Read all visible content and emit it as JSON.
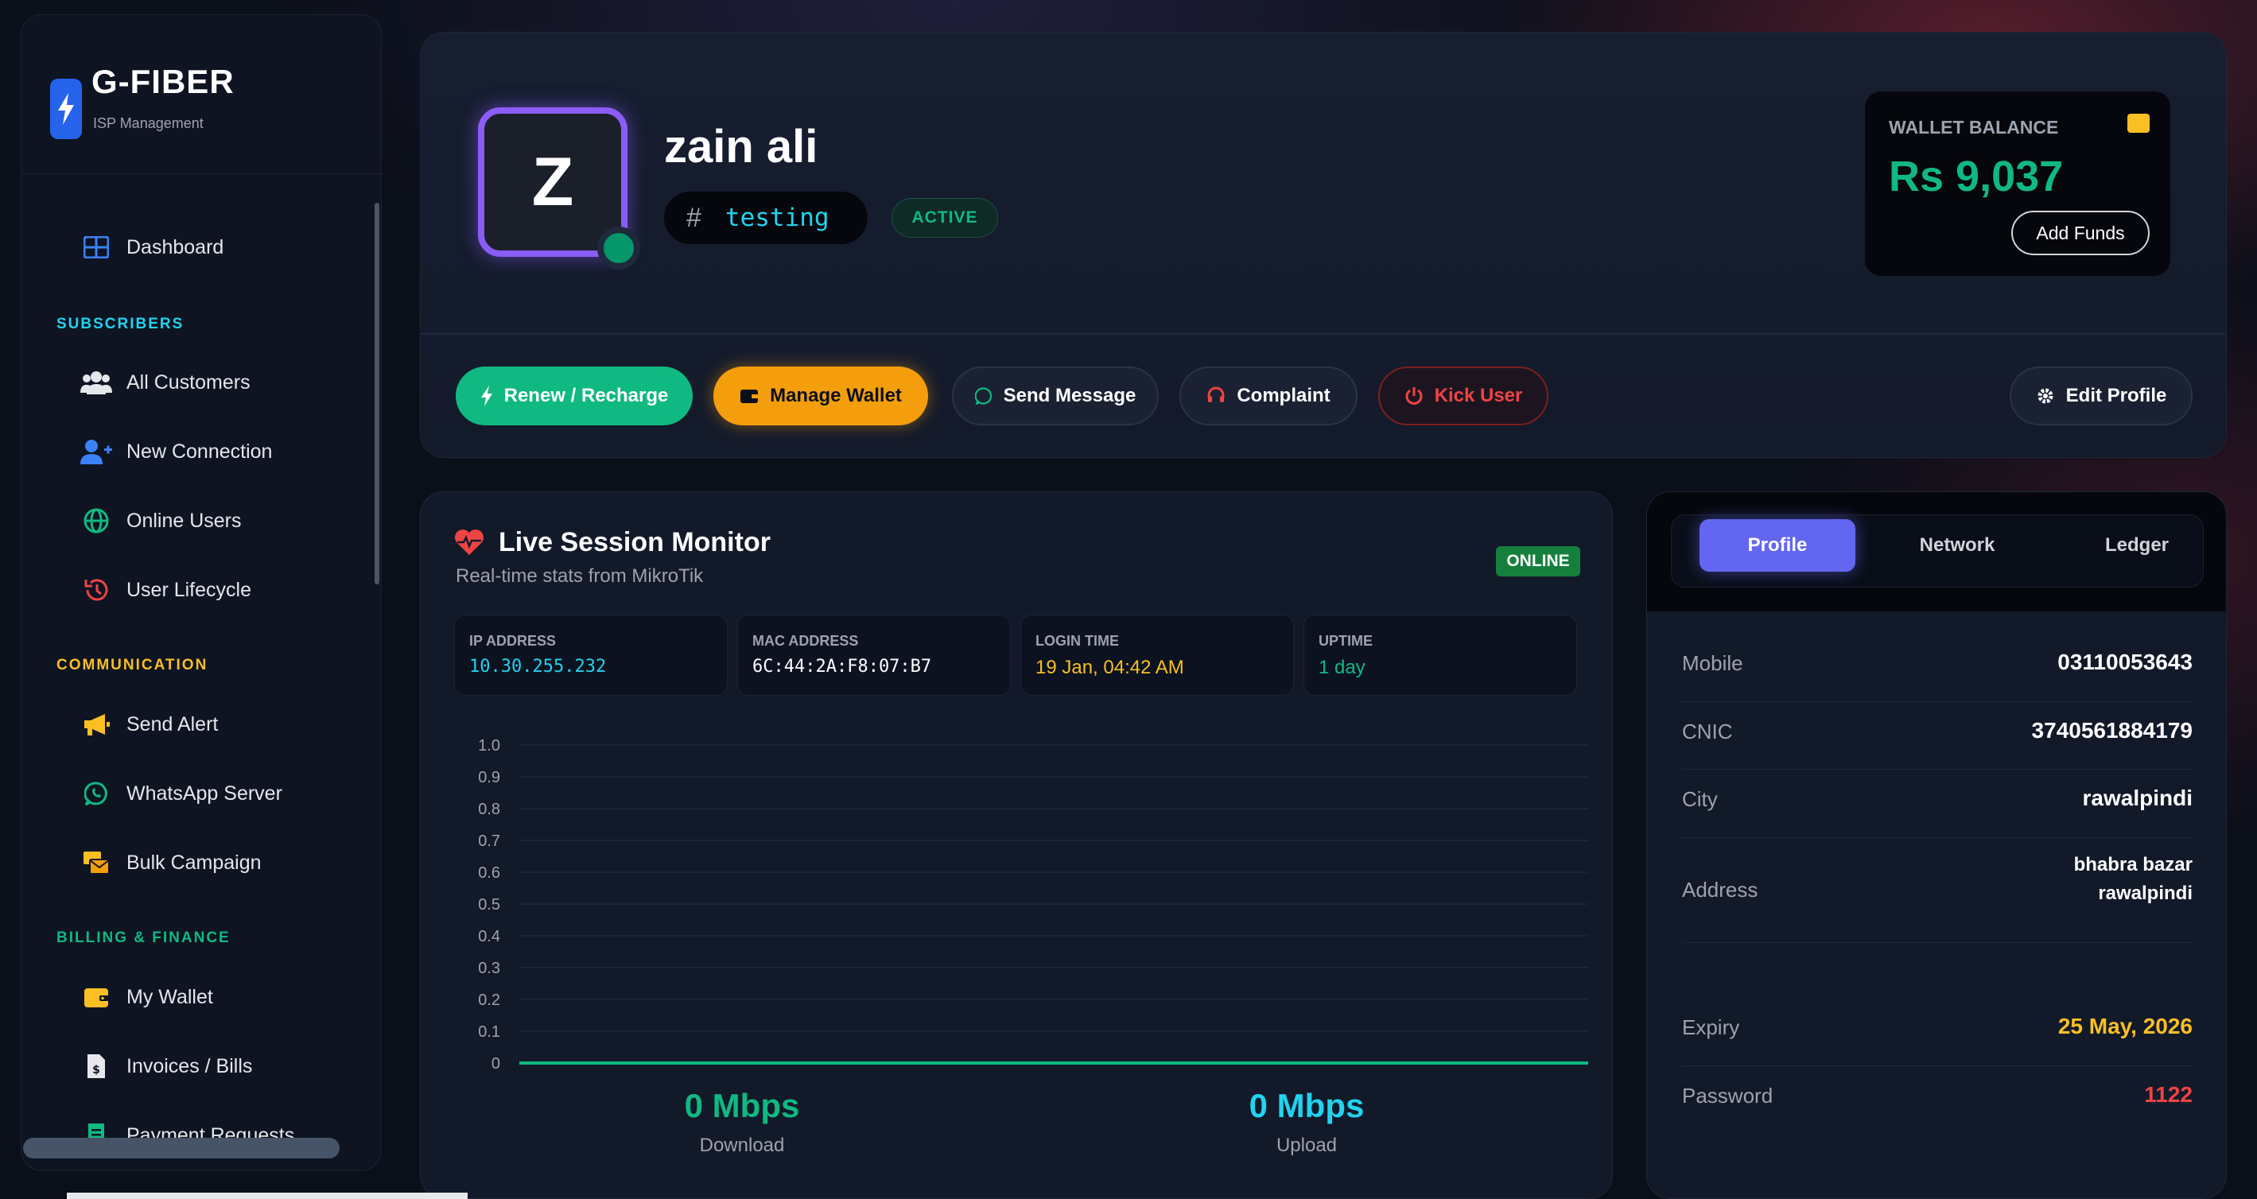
{
  "brand": {
    "name": "G-FIBER",
    "subtitle": "ISP Management"
  },
  "sidebar": {
    "dashboard": "Dashboard",
    "sections": [
      {
        "title": "SUBSCRIBERS",
        "color": "#22d3ee"
      },
      {
        "title": "COMMUNICATION",
        "color": "#fbbf24"
      },
      {
        "title": "BILLING & FINANCE",
        "color": "#10b981"
      }
    ],
    "items": [
      {
        "label": "All Customers",
        "icon": "users-icon"
      },
      {
        "label": "New Connection",
        "icon": "user-plus-icon"
      },
      {
        "label": "Online Users",
        "icon": "globe-icon"
      },
      {
        "label": "User Lifecycle",
        "icon": "history-icon"
      },
      {
        "label": "Send Alert",
        "icon": "megaphone-icon"
      },
      {
        "label": "WhatsApp Server",
        "icon": "whatsapp-icon"
      },
      {
        "label": "Bulk Campaign",
        "icon": "mail-bulk-icon"
      },
      {
        "label": "My Wallet",
        "icon": "wallet-icon"
      },
      {
        "label": "Invoices / Bills",
        "icon": "invoice-icon"
      },
      {
        "label": "Payment Requests",
        "icon": "receipt-icon"
      }
    ]
  },
  "profile": {
    "avatar_letter": "Z",
    "name": "zain ali",
    "username": "testing",
    "status": "ACTIVE"
  },
  "wallet": {
    "label": "WALLET BALANCE",
    "amount": "Rs 9,037",
    "add_funds": "Add Funds"
  },
  "actions": {
    "renew": "Renew / Recharge",
    "manage_wallet": "Manage Wallet",
    "send_message": "Send Message",
    "complaint": "Complaint",
    "kick_user": "Kick User",
    "edit_profile": "Edit Profile"
  },
  "session": {
    "title": "Live Session Monitor",
    "subtitle": "Real-time stats from MikroTik",
    "status": "ONLINE",
    "stats": [
      {
        "label": "IP ADDRESS",
        "value": "10.30.255.232",
        "color": "#22d3ee",
        "mono": true
      },
      {
        "label": "MAC ADDRESS",
        "value": "6C:44:2A:F8:07:B7",
        "color": "#ffffff",
        "mono": true
      },
      {
        "label": "LOGIN TIME",
        "value": "19 Jan, 04:42 AM",
        "color": "#fbbf24",
        "mono": false
      },
      {
        "label": "UPTIME",
        "value": "1 day",
        "color": "#10b981",
        "mono": false
      }
    ],
    "download": {
      "value": "0 Mbps",
      "label": "Download"
    },
    "upload": {
      "value": "0 Mbps",
      "label": "Upload"
    }
  },
  "chart_data": {
    "type": "line",
    "title": "",
    "ylim": [
      0,
      1.0
    ],
    "y_ticks": [
      "1.0",
      "0.9",
      "0.8",
      "0.7",
      "0.6",
      "0.5",
      "0.4",
      "0.3",
      "0.2",
      "0.1",
      "0"
    ],
    "grid": true,
    "series": [
      {
        "values": [
          0,
          0
        ],
        "color": "#10b981"
      }
    ]
  },
  "details": {
    "tabs": [
      "Profile",
      "Network",
      "Ledger"
    ],
    "active_tab": "Profile",
    "rows": [
      {
        "key": "Mobile",
        "value": "03110053643",
        "color": "#ffffff"
      },
      {
        "key": "CNIC",
        "value": "3740561884179",
        "color": "#ffffff"
      },
      {
        "key": "City",
        "value": "rawalpindi",
        "color": "#ffffff"
      },
      {
        "key": "Address",
        "value_lines": [
          "bhabra bazar",
          "rawalpindi"
        ],
        "color": "#ffffff"
      },
      {
        "key": "Expiry",
        "value": "25 May, 2026",
        "color": "#fbbf24"
      },
      {
        "key": "Password",
        "value": "1122",
        "color": "#ef4444"
      }
    ]
  }
}
